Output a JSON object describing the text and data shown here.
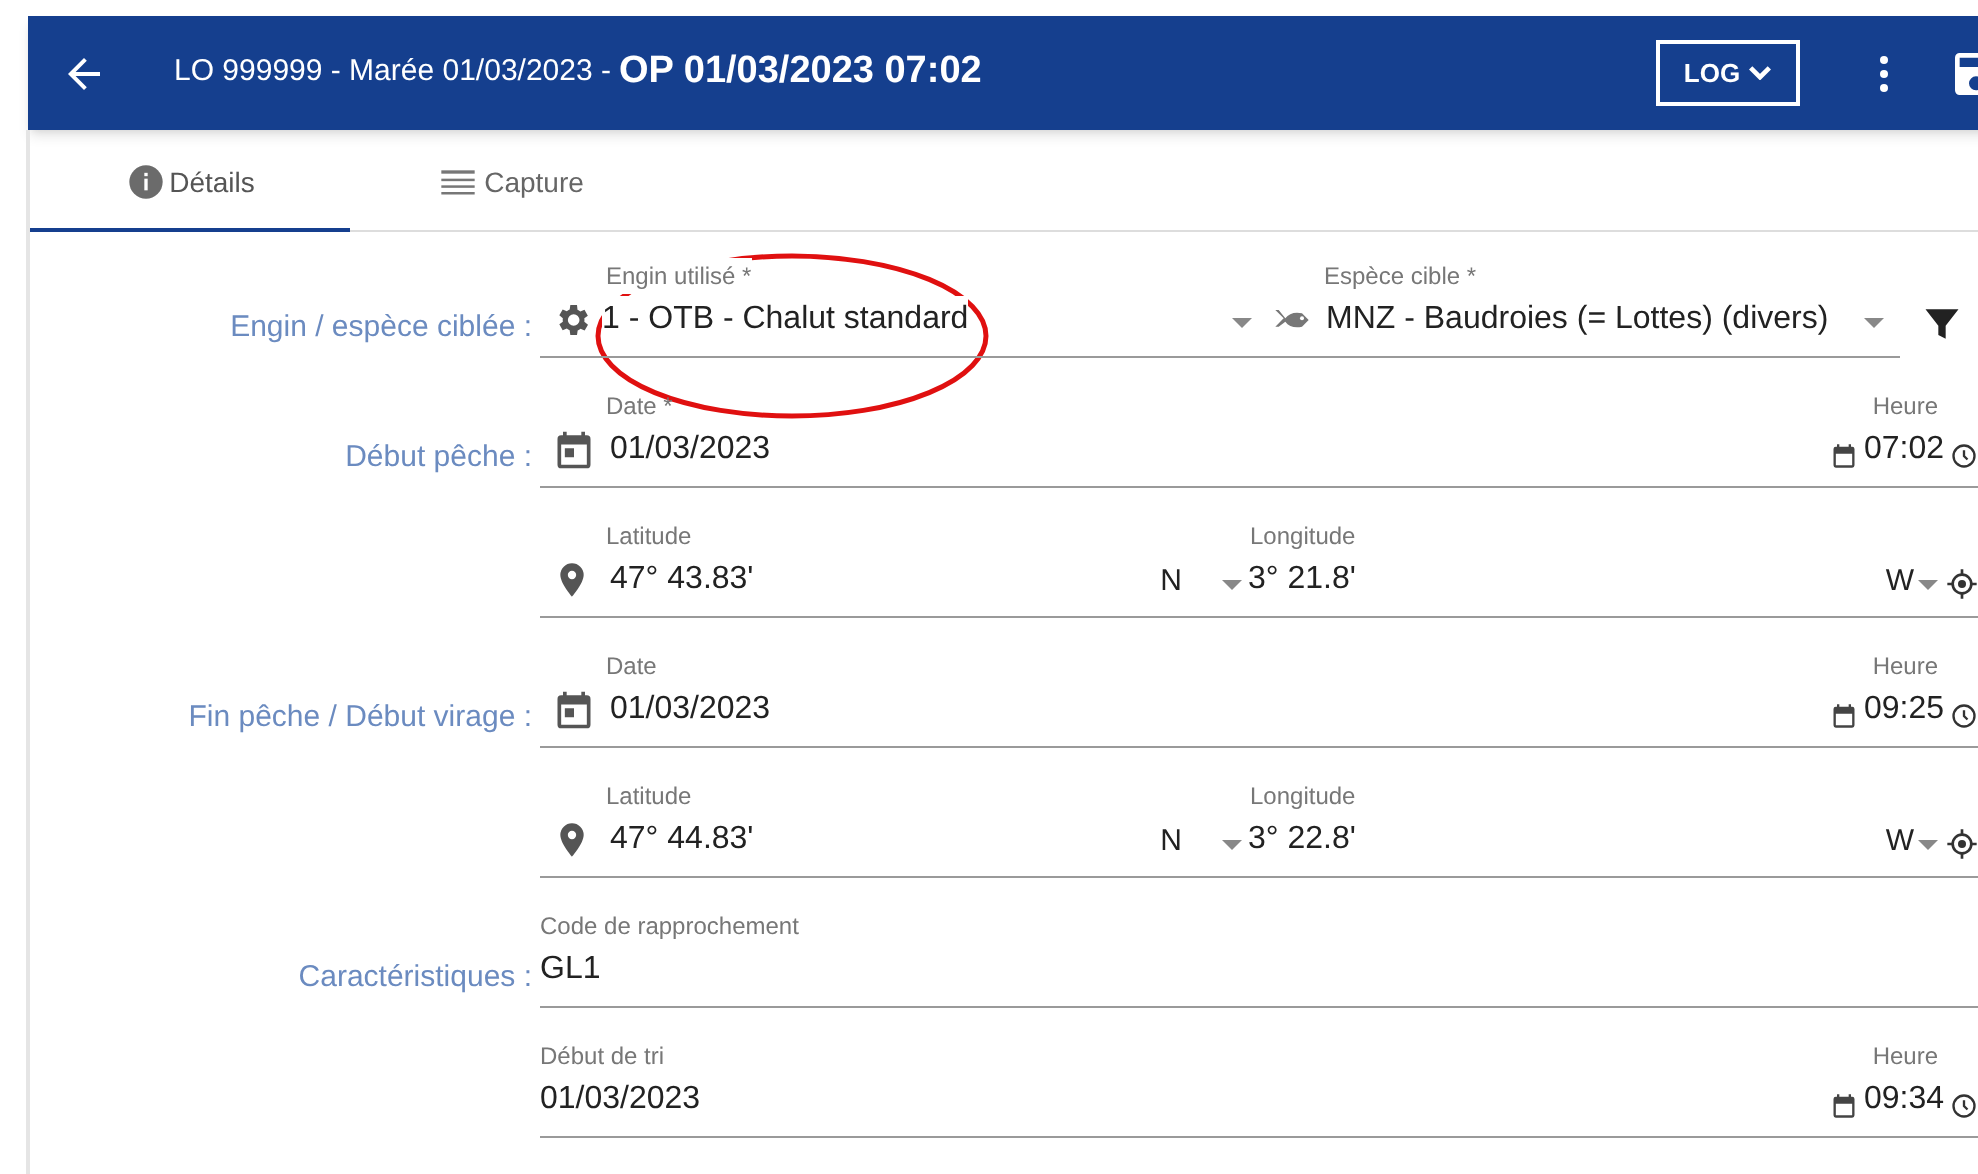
{
  "header": {
    "back": true,
    "subtitle": "LO 999999 - Marée 01/03/2023 - ",
    "title": "OP 01/03/2023 07:02",
    "log_button": "LOG"
  },
  "tabs": [
    {
      "label": "Détails",
      "kind": "info",
      "selected": true
    },
    {
      "label": "Capture",
      "kind": "table",
      "selected": false
    }
  ],
  "sections": [
    {
      "label": "Engin / espèce ciblée :",
      "rows": [
        {
          "kind": "gear_species",
          "gear": {
            "label": "Engin utilisé *",
            "value": "1 - OTB - Chalut standard"
          },
          "species": {
            "label": "Espèce cible *",
            "value": "MNZ - Baudroies (= Lottes) (divers)"
          }
        }
      ]
    },
    {
      "label": "Début pêche :",
      "rows": [
        {
          "kind": "datetime",
          "date": {
            "label": "Date *",
            "value": "01/03/2023"
          },
          "time": {
            "label": "Heure",
            "value": "07:02"
          }
        },
        {
          "kind": "position",
          "latitude": {
            "label": "Latitude",
            "value": "47° 43.83'",
            "hemisphere": "N"
          },
          "longitude": {
            "label": "Longitude",
            "value": "3° 21.8'",
            "hemisphere": "W"
          }
        }
      ]
    },
    {
      "label": "Fin pêche / Début virage :",
      "rows": [
        {
          "kind": "datetime",
          "date": {
            "label": "Date",
            "value": "01/03/2023"
          },
          "time": {
            "label": "Heure",
            "value": "09:25"
          }
        },
        {
          "kind": "position",
          "latitude": {
            "label": "Latitude",
            "value": "47° 44.83'",
            "hemisphere": "N"
          },
          "longitude": {
            "label": "Longitude",
            "value": "3° 22.8'",
            "hemisphere": "W"
          }
        }
      ]
    },
    {
      "label": "Caractéristiques :",
      "rows": [
        {
          "kind": "text",
          "field": {
            "label": "Code de rapprochement",
            "value": "GL1"
          }
        },
        {
          "kind": "datetime_plain",
          "date": {
            "label": "Début de tri",
            "value": "01/03/2023"
          },
          "time": {
            "label": "Heure",
            "value": "09:34"
          }
        }
      ]
    }
  ],
  "annotation": {
    "kind": "ellipse"
  }
}
